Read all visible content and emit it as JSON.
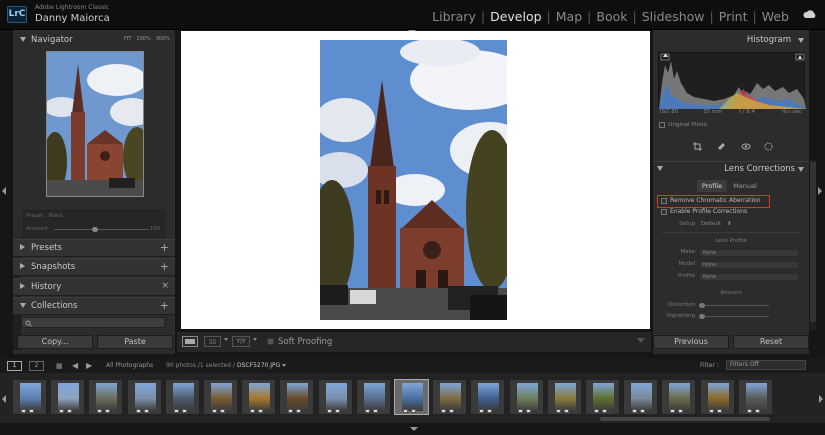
{
  "app": {
    "name": "Adobe Lightroom Classic",
    "logo": "LrC",
    "user": "Danny Maiorca"
  },
  "modules": {
    "items": [
      "Library",
      "Develop",
      "Map",
      "Book",
      "Slideshow",
      "Print",
      "Web"
    ],
    "active": "Develop"
  },
  "navigator": {
    "title": "Navigator",
    "options": [
      "FIT",
      "100%",
      "300%"
    ]
  },
  "preset_info": {
    "preset": "Preset : None",
    "amount": "Amount",
    "amount_value": "100"
  },
  "left_panels": {
    "presets": "Presets",
    "snapshots": "Snapshots",
    "history": "History",
    "collections": "Collections"
  },
  "left_buttons": {
    "copy": "Copy...",
    "paste": "Paste"
  },
  "toolbar": {
    "soft_proofing": "Soft Proofing",
    "yy": "Y|Y"
  },
  "histogram": {
    "title": "Histogram",
    "iso": "ISO 80",
    "focal": "35 mm",
    "aperture": "f / 6.4",
    "shutter": "¹⁄₈₀₀ sec",
    "original_photo": "Original Photo"
  },
  "lens": {
    "title": "Lens Corrections",
    "tabs": [
      "Profile",
      "Manual"
    ],
    "active_tab": "Profile",
    "remove_ca": "Remove Chromatic Aberration",
    "enable_profile": "Enable Profile Corrections",
    "setup_label": "Setup",
    "setup_value": "Default",
    "lens_profile": "Lens Profile",
    "make_label": "Make",
    "make_value": "None",
    "model_label": "Model",
    "model_value": "None",
    "profile_label": "Profile",
    "profile_value": "None",
    "amount": "Amount",
    "distortion": "Distortion",
    "vignetting": "Vignetting"
  },
  "right_buttons": {
    "previous": "Previous",
    "reset": "Reset"
  },
  "filmstrip": {
    "pages": [
      "1",
      "2"
    ],
    "source": "All Photographs",
    "count": "90 photos /1 selected /",
    "file": "DSCF5270.JPG",
    "filter_label": "Filter :",
    "filter_value": "Filters Off"
  },
  "colors": {
    "accent": "#e2e2e2",
    "highlight_box": "#d9381e"
  }
}
